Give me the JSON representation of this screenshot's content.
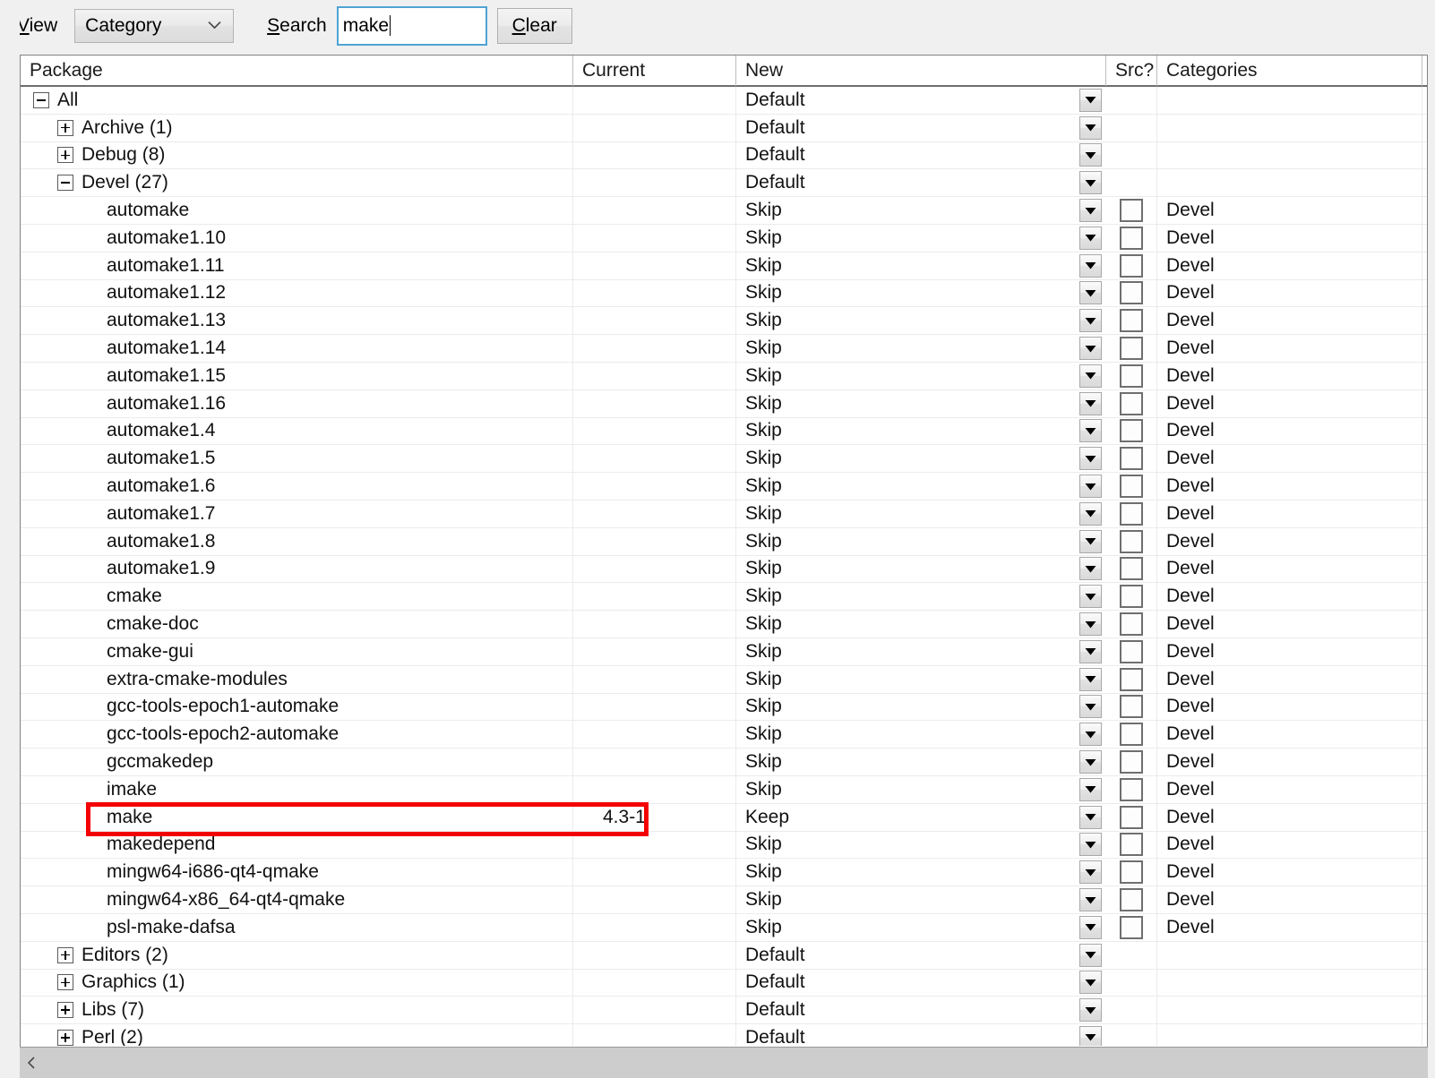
{
  "toolbar": {
    "view_label_prefix": "V",
    "view_label_rest": "iew",
    "view_label_full": "View",
    "view_select_value": "Category",
    "view_select_icon": "chevron-down-icon",
    "search_label_prefix": "S",
    "search_label_rest": "earch",
    "search_label_full": "Search",
    "search_value": "make",
    "search_placeholder": "",
    "clear_label_prefix": "C",
    "clear_label_rest": "lear",
    "clear_label_full": "Clear"
  },
  "table": {
    "columns": [
      "Package",
      "Current",
      "New",
      "Src?",
      "Categories"
    ],
    "dropdown_icon": "caret-down-icon",
    "checkbox_icon": "checkbox-unchecked-icon",
    "rows": [
      {
        "indent": 0,
        "twisty": "minus",
        "package": "All",
        "current": "",
        "new": "Default",
        "src": false,
        "cat": ""
      },
      {
        "indent": 1,
        "twisty": "plus",
        "package": "Archive (1)",
        "current": "",
        "new": "Default",
        "src": false,
        "cat": ""
      },
      {
        "indent": 1,
        "twisty": "plus",
        "package": "Debug (8)",
        "current": "",
        "new": "Default",
        "src": false,
        "cat": ""
      },
      {
        "indent": 1,
        "twisty": "minus",
        "package": "Devel (27)",
        "current": "",
        "new": "Default",
        "src": false,
        "cat": ""
      },
      {
        "indent": 2,
        "twisty": "none",
        "package": "automake",
        "current": "",
        "new": "Skip",
        "src": true,
        "cat": "Devel"
      },
      {
        "indent": 2,
        "twisty": "none",
        "package": "automake1.10",
        "current": "",
        "new": "Skip",
        "src": true,
        "cat": "Devel"
      },
      {
        "indent": 2,
        "twisty": "none",
        "package": "automake1.11",
        "current": "",
        "new": "Skip",
        "src": true,
        "cat": "Devel"
      },
      {
        "indent": 2,
        "twisty": "none",
        "package": "automake1.12",
        "current": "",
        "new": "Skip",
        "src": true,
        "cat": "Devel"
      },
      {
        "indent": 2,
        "twisty": "none",
        "package": "automake1.13",
        "current": "",
        "new": "Skip",
        "src": true,
        "cat": "Devel"
      },
      {
        "indent": 2,
        "twisty": "none",
        "package": "automake1.14",
        "current": "",
        "new": "Skip",
        "src": true,
        "cat": "Devel"
      },
      {
        "indent": 2,
        "twisty": "none",
        "package": "automake1.15",
        "current": "",
        "new": "Skip",
        "src": true,
        "cat": "Devel"
      },
      {
        "indent": 2,
        "twisty": "none",
        "package": "automake1.16",
        "current": "",
        "new": "Skip",
        "src": true,
        "cat": "Devel"
      },
      {
        "indent": 2,
        "twisty": "none",
        "package": "automake1.4",
        "current": "",
        "new": "Skip",
        "src": true,
        "cat": "Devel"
      },
      {
        "indent": 2,
        "twisty": "none",
        "package": "automake1.5",
        "current": "",
        "new": "Skip",
        "src": true,
        "cat": "Devel"
      },
      {
        "indent": 2,
        "twisty": "none",
        "package": "automake1.6",
        "current": "",
        "new": "Skip",
        "src": true,
        "cat": "Devel"
      },
      {
        "indent": 2,
        "twisty": "none",
        "package": "automake1.7",
        "current": "",
        "new": "Skip",
        "src": true,
        "cat": "Devel"
      },
      {
        "indent": 2,
        "twisty": "none",
        "package": "automake1.8",
        "current": "",
        "new": "Skip",
        "src": true,
        "cat": "Devel"
      },
      {
        "indent": 2,
        "twisty": "none",
        "package": "automake1.9",
        "current": "",
        "new": "Skip",
        "src": true,
        "cat": "Devel"
      },
      {
        "indent": 2,
        "twisty": "none",
        "package": "cmake",
        "current": "",
        "new": "Skip",
        "src": true,
        "cat": "Devel"
      },
      {
        "indent": 2,
        "twisty": "none",
        "package": "cmake-doc",
        "current": "",
        "new": "Skip",
        "src": true,
        "cat": "Devel"
      },
      {
        "indent": 2,
        "twisty": "none",
        "package": "cmake-gui",
        "current": "",
        "new": "Skip",
        "src": true,
        "cat": "Devel"
      },
      {
        "indent": 2,
        "twisty": "none",
        "package": "extra-cmake-modules",
        "current": "",
        "new": "Skip",
        "src": true,
        "cat": "Devel"
      },
      {
        "indent": 2,
        "twisty": "none",
        "package": "gcc-tools-epoch1-automake",
        "current": "",
        "new": "Skip",
        "src": true,
        "cat": "Devel"
      },
      {
        "indent": 2,
        "twisty": "none",
        "package": "gcc-tools-epoch2-automake",
        "current": "",
        "new": "Skip",
        "src": true,
        "cat": "Devel"
      },
      {
        "indent": 2,
        "twisty": "none",
        "package": "gccmakedep",
        "current": "",
        "new": "Skip",
        "src": true,
        "cat": "Devel"
      },
      {
        "indent": 2,
        "twisty": "none",
        "package": "imake",
        "current": "",
        "new": "Skip",
        "src": true,
        "cat": "Devel"
      },
      {
        "indent": 2,
        "twisty": "none",
        "package": "make",
        "current": "4.3-1",
        "new": "Keep",
        "src": true,
        "cat": "Devel",
        "highlighted": true
      },
      {
        "indent": 2,
        "twisty": "none",
        "package": "makedepend",
        "current": "",
        "new": "Skip",
        "src": true,
        "cat": "Devel"
      },
      {
        "indent": 2,
        "twisty": "none",
        "package": "mingw64-i686-qt4-qmake",
        "current": "",
        "new": "Skip",
        "src": true,
        "cat": "Devel"
      },
      {
        "indent": 2,
        "twisty": "none",
        "package": "mingw64-x86_64-qt4-qmake",
        "current": "",
        "new": "Skip",
        "src": true,
        "cat": "Devel"
      },
      {
        "indent": 2,
        "twisty": "none",
        "package": "psl-make-dafsa",
        "current": "",
        "new": "Skip",
        "src": true,
        "cat": "Devel"
      },
      {
        "indent": 1,
        "twisty": "plus",
        "package": "Editors (2)",
        "current": "",
        "new": "Default",
        "src": false,
        "cat": ""
      },
      {
        "indent": 1,
        "twisty": "plus",
        "package": "Graphics (1)",
        "current": "",
        "new": "Default",
        "src": false,
        "cat": ""
      },
      {
        "indent": 1,
        "twisty": "plus",
        "package": "Libs (7)",
        "current": "",
        "new": "Default",
        "src": false,
        "cat": ""
      },
      {
        "indent": 1,
        "twisty": "plus",
        "package": "Perl (2)",
        "current": "",
        "new": "Default",
        "src": false,
        "cat": ""
      }
    ]
  },
  "annotation": {
    "type": "red-rectangle-highlight",
    "target_package": "make",
    "color": "#f40000"
  },
  "scrollbar": {
    "orientation": "horizontal",
    "left_arrow_icon": "chevron-left-icon"
  }
}
